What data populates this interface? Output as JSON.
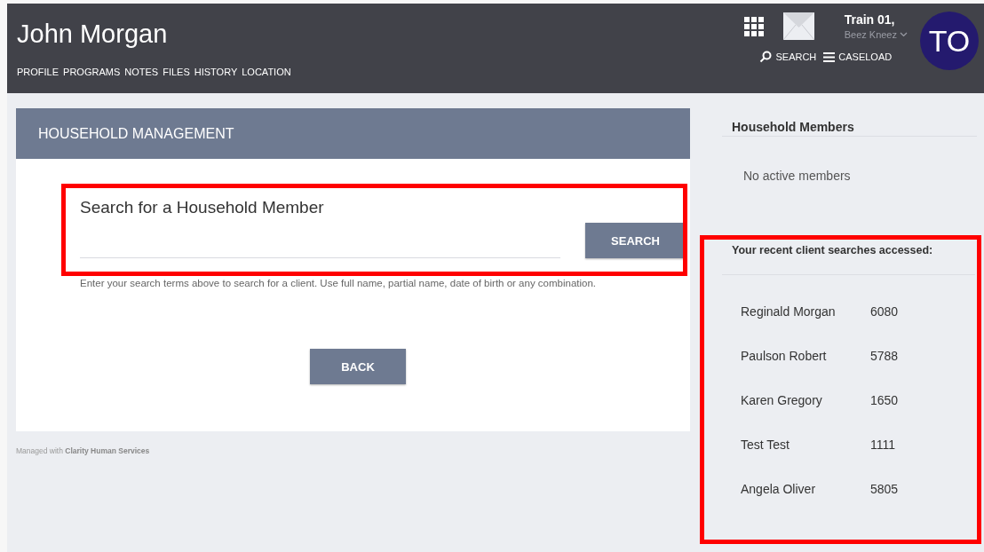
{
  "header": {
    "client_name": "John Morgan",
    "nav": [
      "PROFILE",
      "PROGRAMS",
      "NOTES",
      "FILES",
      "HISTORY",
      "LOCATION"
    ],
    "user": {
      "name": "Train 01,",
      "agency": "Beez Kneez",
      "avatar": "TO"
    },
    "actions": [
      {
        "kind": "search",
        "label": "SEARCH"
      },
      {
        "kind": "menu",
        "label": "CASELOAD"
      }
    ]
  },
  "panel": {
    "title": "HOUSEHOLD MANAGEMENT",
    "search_heading": "Search for a Household Member",
    "search_button": "SEARCH",
    "help": "Enter your search terms above to search for a client. Use full name, partial name, date of birth or any combination.",
    "back_button": "BACK"
  },
  "footer": {
    "prefix": "Managed with ",
    "brand": "Clarity Human Services"
  },
  "sidebar": {
    "members_title": "Household Members",
    "members_empty": "No active members",
    "recent_title": "Your recent client searches accessed:",
    "recent": [
      {
        "name": "Reginald Morgan",
        "id": "6080"
      },
      {
        "name": "Paulson Robert",
        "id": "5788"
      },
      {
        "name": "Karen Gregory",
        "id": "1650"
      },
      {
        "name": "Test Test",
        "id": "1111"
      },
      {
        "name": "Angela Oliver",
        "id": "5805"
      }
    ]
  }
}
